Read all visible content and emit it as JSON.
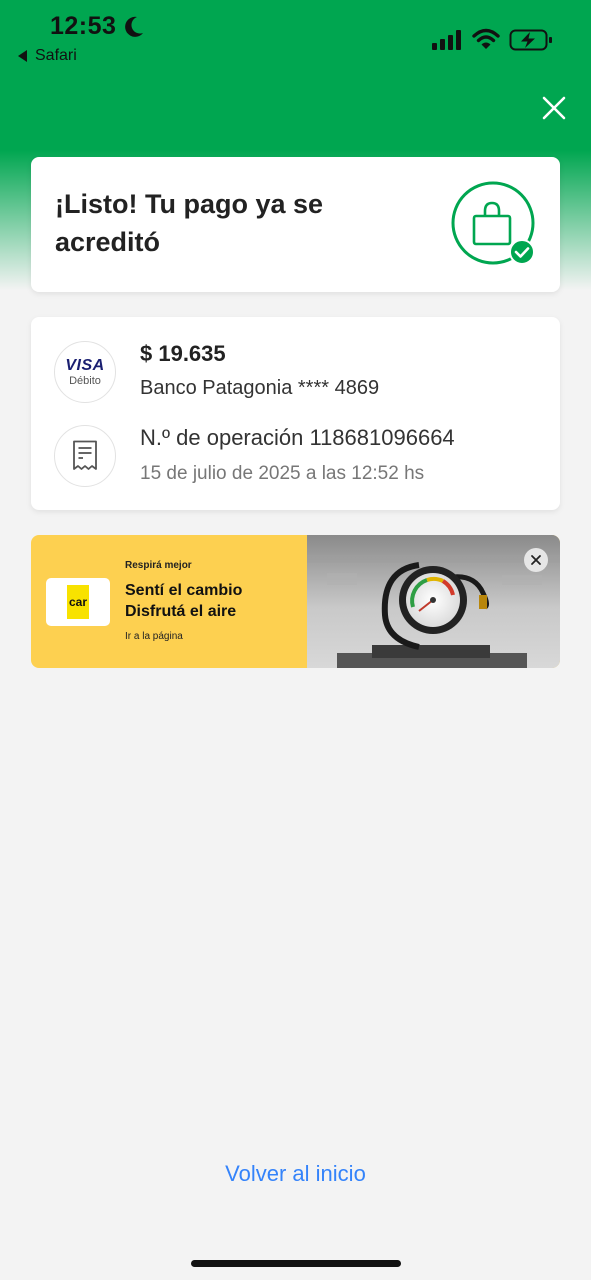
{
  "status_bar": {
    "time": "12:53",
    "back_app": "Safari",
    "icons": [
      "moon-icon",
      "signal-icon",
      "wifi-icon",
      "battery-charging-icon"
    ]
  },
  "header": {
    "close_icon": "close-icon"
  },
  "success": {
    "title": "¡Listo! Tu pago ya se acreditó",
    "icon": "shopping-bag-check-icon"
  },
  "payment": {
    "card_brand": "VISA",
    "card_type": "Débito",
    "amount": "$ 19.635",
    "bank": "Banco Patagonia **** 4869",
    "operation": "N.º de operación 118681096664",
    "date": "15 de julio de 2025 a las 12:52 hs"
  },
  "ad": {
    "logo_text": "car",
    "eyebrow": "Respirá mejor",
    "headline_1": "Sentí el cambio",
    "headline_2": "Disfrutá el aire",
    "link": "Ir a la página",
    "image": "tire-pressure-gauge"
  },
  "footer": {
    "home_link": "Volver al inicio"
  },
  "colors": {
    "brand_green": "#00a650",
    "link_blue": "#3483fa",
    "ad_yellow": "#fdd050"
  }
}
